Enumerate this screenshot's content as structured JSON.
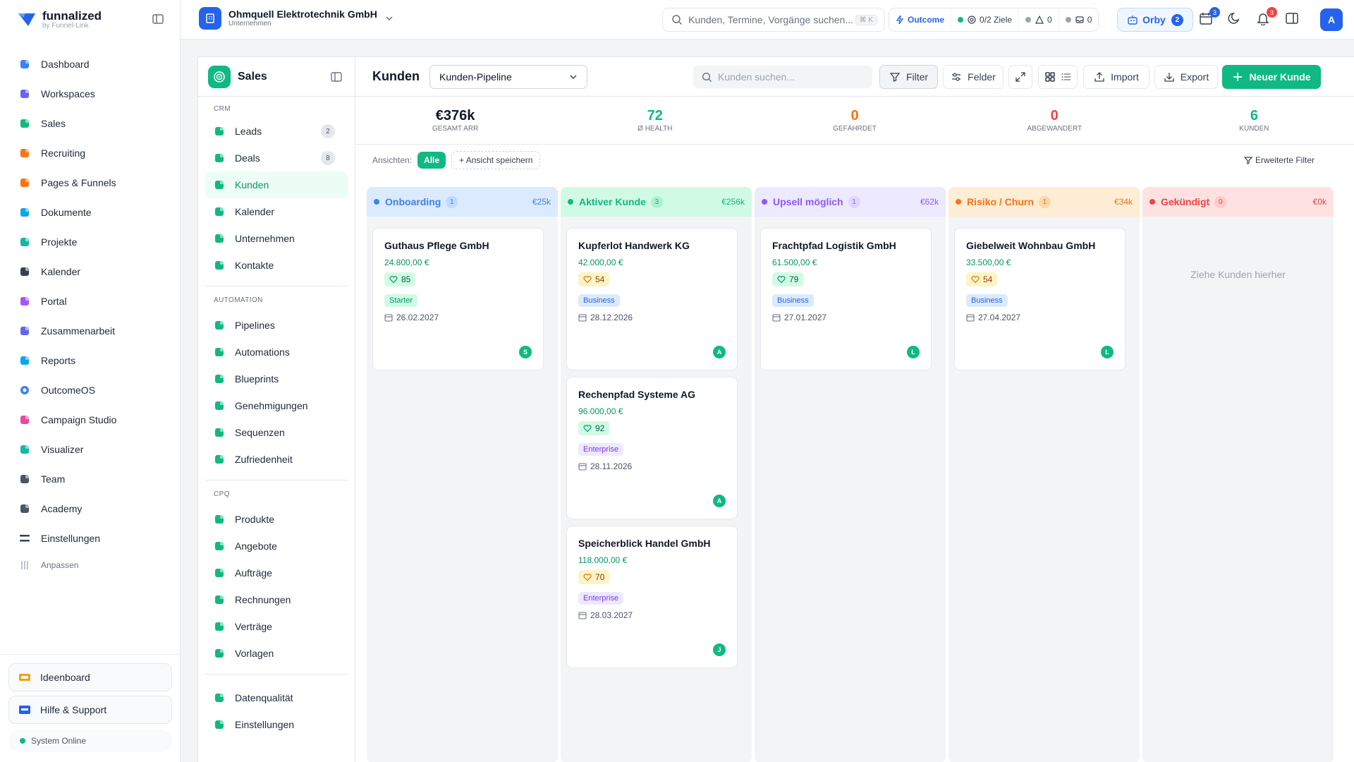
{
  "brand": {
    "name": "funnalized",
    "sub": "by Funnel-Link"
  },
  "nav": [
    {
      "label": "Dashboard",
      "icon": "dashboard-icon",
      "color": "#3b82f6"
    },
    {
      "label": "Workspaces",
      "icon": "workspaces-icon",
      "color": "#6366f1"
    },
    {
      "label": "Sales",
      "icon": "sales-icon",
      "color": "#10b981"
    },
    {
      "label": "Recruiting",
      "icon": "recruiting-icon",
      "color": "#f97316"
    },
    {
      "label": "Pages & Funnels",
      "icon": "funnel-icon",
      "color": "#f97316"
    },
    {
      "label": "Dokumente",
      "icon": "document-icon",
      "color": "#0ea5e9"
    },
    {
      "label": "Projekte",
      "icon": "projects-icon",
      "color": "#14b8a6"
    },
    {
      "label": "Kalender",
      "icon": "calendar-icon",
      "color": "#374151"
    },
    {
      "label": "Portal",
      "icon": "portal-icon",
      "color": "#a855f7"
    },
    {
      "label": "Zusammenarbeit",
      "icon": "collaboration-icon",
      "color": "#6366f1"
    },
    {
      "label": "Reports",
      "icon": "reports-icon",
      "color": "#0ea5e9"
    },
    {
      "label": "OutcomeOS",
      "icon": "outcome-icon",
      "color": "#3b82f6"
    },
    {
      "label": "Campaign Studio",
      "icon": "flag-icon",
      "color": "#ec4899"
    },
    {
      "label": "Visualizer",
      "icon": "visualizer-icon",
      "color": "#14b8a6"
    },
    {
      "label": "Team",
      "icon": "team-icon",
      "color": "#4b5563"
    },
    {
      "label": "Academy",
      "icon": "academy-icon",
      "color": "#4b5563"
    },
    {
      "label": "Einstellungen",
      "icon": "settings-icon",
      "color": "#374151"
    }
  ],
  "nav_customize": "Anpassen",
  "side_bottom": {
    "ideas": "Ideenboard",
    "help": "Hilfe & Support",
    "status": "System Online"
  },
  "company": {
    "name": "Ohmquell Elektrotechnik GmbH",
    "sub": "Unternehmen"
  },
  "global_search": {
    "placeholder": "Kunden, Termine, Vorgänge suchen...",
    "shortcut": "⌘ K"
  },
  "status": {
    "outcome": "Outcome",
    "goals": "0/2 Ziele",
    "alerts": "0",
    "inbox": "0"
  },
  "orby": {
    "label": "Orby",
    "badge": "2"
  },
  "header_badges": {
    "calendar": "3",
    "notifications": "3"
  },
  "user_initial": "A",
  "sales": {
    "title": "Sales",
    "crm_label": "CRM",
    "crm": [
      {
        "label": "Leads",
        "count": "2"
      },
      {
        "label": "Deals",
        "count": "8"
      },
      {
        "label": "Kunden"
      },
      {
        "label": "Kalender"
      },
      {
        "label": "Unternehmen"
      },
      {
        "label": "Kontakte"
      }
    ],
    "automation_label": "AUTOMATION",
    "automation": [
      {
        "label": "Pipelines"
      },
      {
        "label": "Automations"
      },
      {
        "label": "Blueprints"
      },
      {
        "label": "Genehmigungen"
      },
      {
        "label": "Sequenzen"
      },
      {
        "label": "Zufriedenheit"
      }
    ],
    "cpq_label": "CPQ",
    "cpq": [
      {
        "label": "Produkte"
      },
      {
        "label": "Angebote"
      },
      {
        "label": "Aufträge"
      },
      {
        "label": "Rechnungen"
      },
      {
        "label": "Verträge"
      },
      {
        "label": "Vorlagen"
      }
    ],
    "extra": [
      {
        "label": "Datenqualität"
      },
      {
        "label": "Einstellungen"
      }
    ]
  },
  "main": {
    "title": "Kunden",
    "pipeline": "Kunden-Pipeline",
    "search_placeholder": "Kunden suchen...",
    "filter": "Filter",
    "fields": "Felder",
    "import": "Import",
    "export": "Export",
    "new": "Neuer Kunde",
    "views_label": "Ansichten:",
    "view_all": "Alle",
    "save_view": "Ansicht speichern",
    "advanced_filter": "Erweiterte Filter"
  },
  "kpis": [
    {
      "value": "€376k",
      "label": "GESAMT ARR",
      "color": "#111827"
    },
    {
      "value": "72",
      "label": "Ø HEALTH",
      "color": "#10b981"
    },
    {
      "value": "0",
      "label": "GEFÄHRDET",
      "color": "#f97316"
    },
    {
      "value": "0",
      "label": "ABGEWANDERT",
      "color": "#ef4444"
    },
    {
      "value": "6",
      "label": "KUNDEN",
      "color": "#10b981"
    }
  ],
  "columns": [
    {
      "title": "Onboarding",
      "count": "1",
      "sum": "€25k",
      "color": "#3b82f6",
      "bg": "#dbeafe",
      "cnt_bg": "#bfdbfe",
      "cards": [
        {
          "name": "Guthaus Pflege GmbH",
          "value": "24.800,00 €",
          "health": "85",
          "plan": "Starter",
          "date": "26.02.2027",
          "owner": "S"
        }
      ]
    },
    {
      "title": "Aktiver Kunde",
      "count": "3",
      "sum": "€256k",
      "color": "#10b981",
      "bg": "#d1fae5",
      "cnt_bg": "#a7f3d0",
      "cards": [
        {
          "name": "Kupferlot Handwerk KG",
          "value": "42.000,00 €",
          "health": "54",
          "plan": "Business",
          "date": "28.12.2026",
          "owner": "A"
        },
        {
          "name": "Rechenpfad Systeme AG",
          "value": "96.000,00 €",
          "health": "92",
          "plan": "Enterprise",
          "date": "28.11.2026",
          "owner": "A"
        },
        {
          "name": "Speicherblick Handel GmbH",
          "value": "118.000,00 €",
          "health": "70",
          "plan": "Enterprise",
          "date": "28.03.2027",
          "owner": "J"
        }
      ]
    },
    {
      "title": "Upsell möglich",
      "count": "1",
      "sum": "€62k",
      "color": "#8b5cf6",
      "bg": "#ede9fe",
      "cnt_bg": "#ddd6fe",
      "cards": [
        {
          "name": "Frachtpfad Logistik GmbH",
          "value": "61.500,00 €",
          "health": "79",
          "plan": "Business",
          "date": "27.01.2027",
          "owner": "L"
        }
      ]
    },
    {
      "title": "Risiko / Churn",
      "count": "1",
      "sum": "€34k",
      "color": "#f97316",
      "bg": "#ffedd5",
      "cnt_bg": "#fed7aa",
      "cards": [
        {
          "name": "Giebelweit Wohnbau GmbH",
          "value": "33.500,00 €",
          "health": "54",
          "plan": "Business",
          "date": "27.04.2027",
          "owner": "L"
        }
      ]
    },
    {
      "title": "Gekündigt",
      "count": "0",
      "sum": "€0k",
      "color": "#ef4444",
      "bg": "#fee2e2",
      "cnt_bg": "#fecaca",
      "cards": [],
      "empty": "Ziehe Kunden hierher"
    }
  ]
}
